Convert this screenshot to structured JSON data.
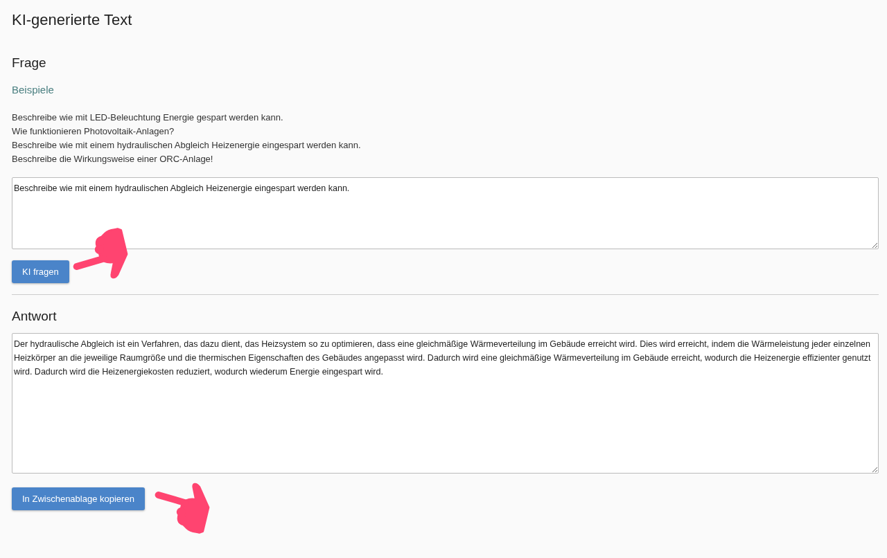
{
  "page_title": "KI-generierte Text",
  "question": {
    "heading": "Frage",
    "examples_label": "Beispiele",
    "examples": [
      "Beschreibe wie mit LED-Beleuchtung Energie gespart werden kann.",
      "Wie funktionieren Photovoltaik-Anlagen?",
      "Beschreibe wie mit einem hydraulischen Abgleich Heizenergie eingespart werden kann.",
      "Beschreibe die Wirkungsweise einer ORC-Anlage!"
    ],
    "input": {
      "value": "Beschreibe wie mit einem hydraulischen Abgleich Heizenergie eingespart werden kann."
    },
    "button": "KI fragen"
  },
  "answer": {
    "heading": "Antwort",
    "output": {
      "value": "Der hydraulische Abgleich ist ein Verfahren, das dazu dient, das Heizsystem so zu optimieren, dass eine gleichmäßige Wärmeverteilung im Gebäude erreicht wird. Dies wird erreicht, indem die Wärmeleistung jeder einzelnen Heizkörper an die jeweilige Raumgröße und die thermischen Eigenschaften des Gebäudes angepasst wird. Dadurch wird eine gleichmäßige Wärmeverteilung im Gebäude erreicht, wodurch die Heizenergie effizienter genutzt wird. Dadurch wird die Heizenergiekosten reduziert, wodurch wiederum Energie eingespart wird."
    },
    "button": "In Zwischenablage kopieren"
  }
}
